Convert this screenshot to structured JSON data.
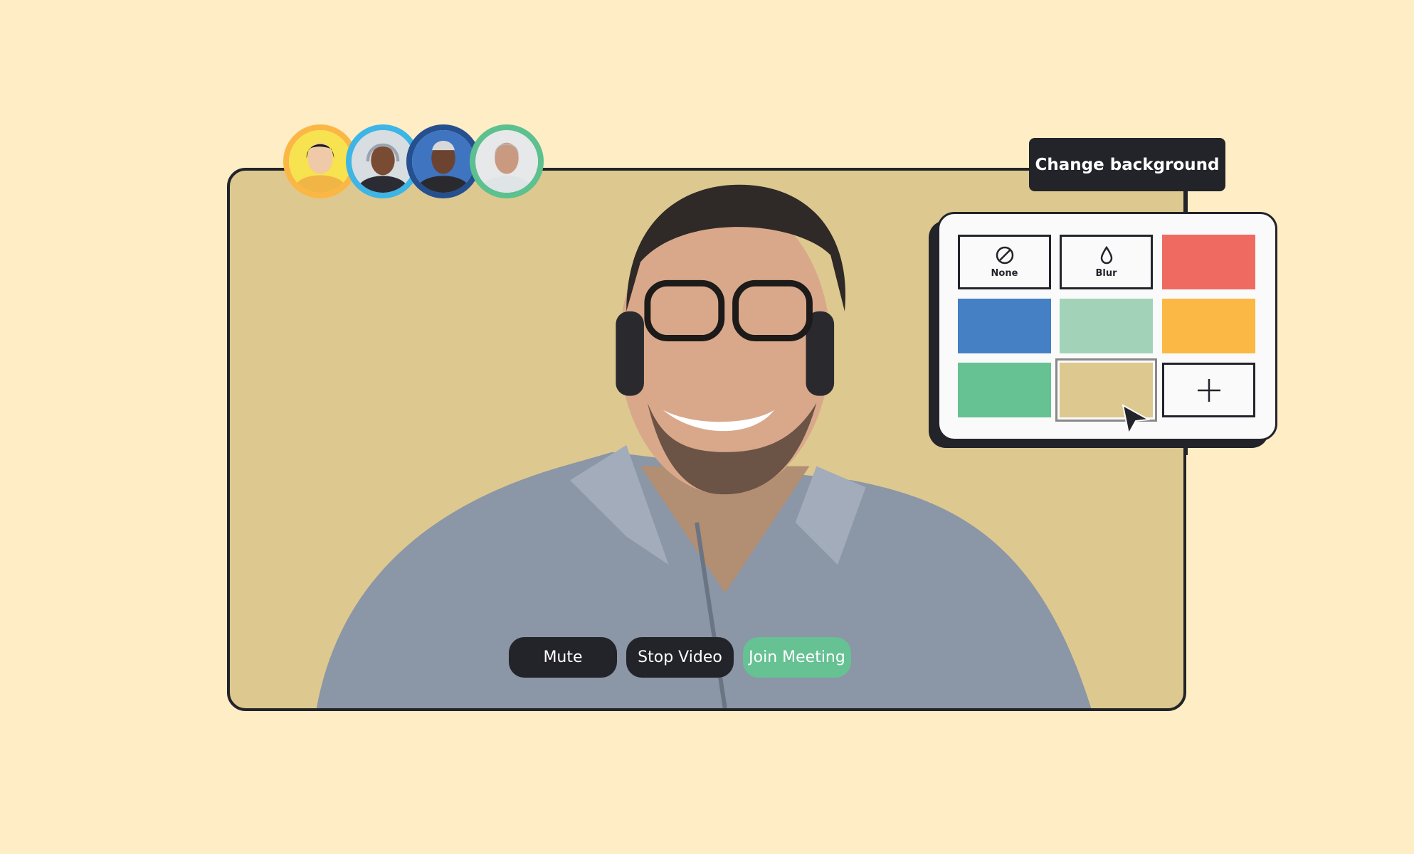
{
  "participants": [
    {
      "name": "participant-1",
      "ring": "#fbb745",
      "bg": "#f7e24f"
    },
    {
      "name": "participant-2",
      "ring": "#3db5e6",
      "bg": "#d8dde2"
    },
    {
      "name": "participant-3",
      "ring": "#254f8e",
      "bg": "#3f74c0"
    },
    {
      "name": "participant-4",
      "ring": "#5cc08f",
      "bg": "#e6e8ea"
    }
  ],
  "tooltip": {
    "label": "Change background"
  },
  "background_options": [
    {
      "type": "none",
      "label": "None",
      "icon": "no-background-icon"
    },
    {
      "type": "blur",
      "label": "Blur",
      "icon": "blur-drop-icon"
    },
    {
      "type": "color",
      "color": "#ef6b61"
    },
    {
      "type": "color",
      "color": "#4580c4"
    },
    {
      "type": "color",
      "color": "#a2d3b8"
    },
    {
      "type": "color",
      "color": "#fbb845"
    },
    {
      "type": "color",
      "color": "#66c193"
    },
    {
      "type": "color",
      "color": "#ddc990",
      "selected": true
    },
    {
      "type": "add",
      "icon": "plus-icon"
    }
  ],
  "controls": {
    "mute": "Mute",
    "stop_video": "Stop Video",
    "join_meeting": "Join Meeting"
  },
  "colors": {
    "page_bg": "#feedc5",
    "video_bg": "#ddc990",
    "dark": "#23232a",
    "join": "#66c193"
  }
}
